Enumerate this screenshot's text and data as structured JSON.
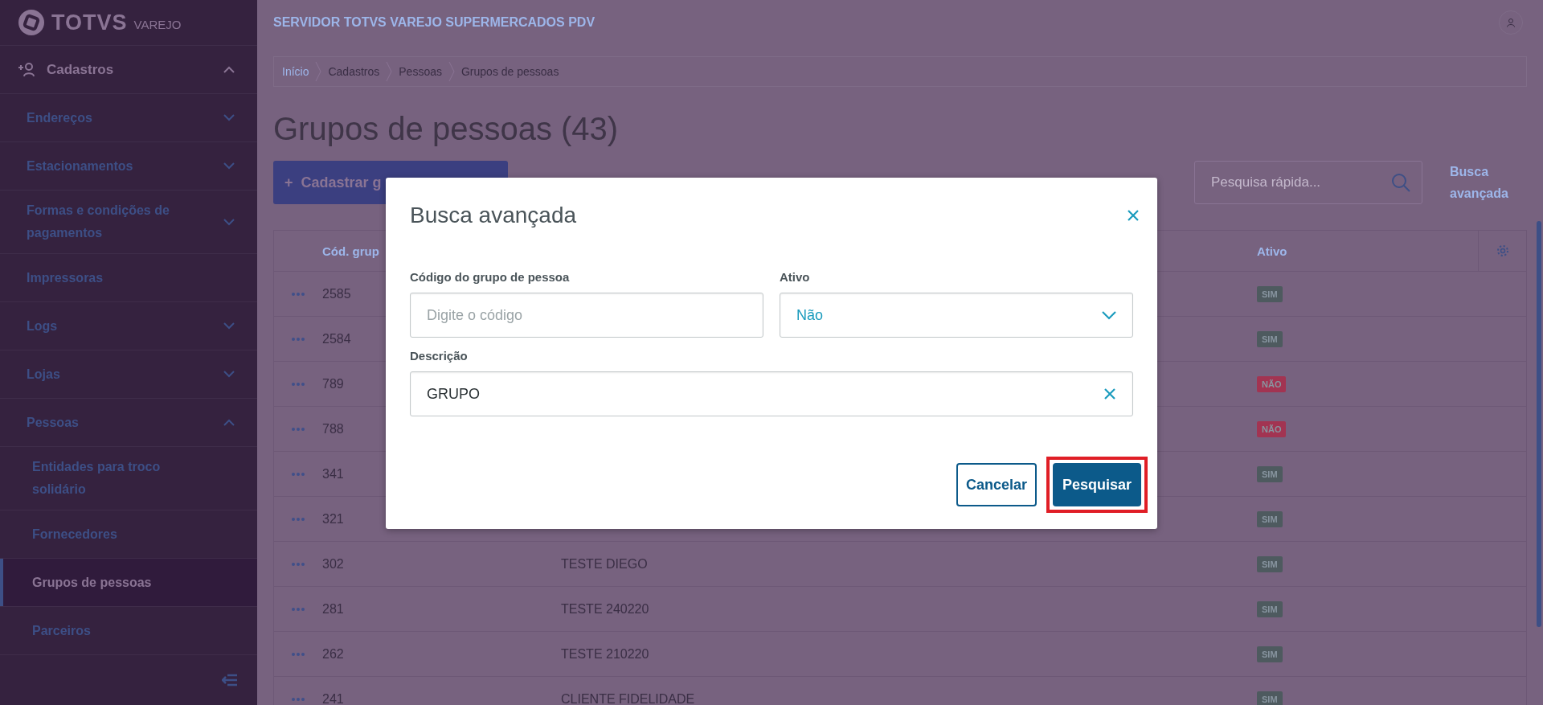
{
  "sidebar": {
    "logo": {
      "brand": "TOTVS",
      "product": "VAREJO"
    },
    "items": [
      {
        "label": "Cadastros",
        "kind": "group",
        "expanded": true,
        "selected": false,
        "children": [
          {
            "label": "Endereços",
            "kind": "group",
            "expanded": false,
            "selected": false
          },
          {
            "label": "Estacionamentos",
            "kind": "group",
            "expanded": false,
            "selected": false
          },
          {
            "label": "Formas e condições de pagamentos",
            "kind": "group",
            "expanded": false,
            "selected": false
          },
          {
            "label": "Impressoras",
            "kind": "link",
            "selected": false
          },
          {
            "label": "Logs",
            "kind": "group",
            "expanded": false,
            "selected": false
          },
          {
            "label": "Lojas",
            "kind": "group",
            "expanded": false,
            "selected": false
          },
          {
            "label": "Pessoas",
            "kind": "group",
            "expanded": true,
            "selected": false,
            "children": [
              {
                "label": "Entidades para troco solidário",
                "kind": "link",
                "selected": false
              },
              {
                "label": "Fornecedores",
                "kind": "link",
                "selected": false
              },
              {
                "label": "Grupos de pessoas",
                "kind": "link",
                "selected": true
              },
              {
                "label": "Parceiros",
                "kind": "link",
                "selected": false
              }
            ]
          }
        ]
      }
    ]
  },
  "header": {
    "title": "SERVIDOR TOTVS VAREJO SUPERMERCADOS PDV"
  },
  "breadcrumb": [
    {
      "label": "Início",
      "kind": "link"
    },
    {
      "label": "Cadastros",
      "kind": "text"
    },
    {
      "label": "Pessoas",
      "kind": "text"
    },
    {
      "label": "Grupos de pessoas",
      "kind": "text"
    }
  ],
  "page_title": "Grupos de pessoas (43)",
  "create_button": {
    "icon": "+",
    "label": "Cadastrar g"
  },
  "search": {
    "placeholder": "Pesquisa rápida..."
  },
  "advanced_search_link": "Busca avançada",
  "table": {
    "columns": [
      "Cód. grup",
      "Ativo"
    ],
    "rows": [
      {
        "code": "2585",
        "active": "SIM",
        "color": "#4e5a5f"
      },
      {
        "code": "2584",
        "active": "SIM",
        "color": "#4e5a5f"
      },
      {
        "code": "789",
        "active": "NÃO",
        "color": "#a23452"
      },
      {
        "code": "788",
        "active": "NÃO",
        "color": "#a23452"
      },
      {
        "code": "341",
        "active": "SIM",
        "color": "#4e5a5f"
      },
      {
        "code": "321",
        "active": "SIM",
        "color": "#4e5a5f"
      },
      {
        "code": "302",
        "description": "TESTE DIEGO",
        "active": "SIM",
        "color": "#4e5a5f"
      },
      {
        "code": "281",
        "description": "TESTE 240220",
        "active": "SIM",
        "color": "#4e5a5f"
      },
      {
        "code": "262",
        "description": "TESTE 210220",
        "active": "SIM",
        "color": "#4e5a5f"
      },
      {
        "code": "241",
        "description": "CLIENTE FIDELIDADE",
        "active": "SIM",
        "color": "#4e5a5f"
      }
    ]
  },
  "modal": {
    "title": "Busca avançada",
    "fields": [
      {
        "kind": "text",
        "label": "Código do grupo de pessoa",
        "placeholder": "Digite o código"
      },
      {
        "kind": "select",
        "label": "Ativo",
        "value": "Não"
      },
      {
        "kind": "clearable",
        "label": "Descrição",
        "value": "GRUPO"
      }
    ],
    "buttons": [
      {
        "label": "Cancelar",
        "kind": "secondary",
        "highlighted": false
      },
      {
        "label": "Pesquisar",
        "kind": "primary",
        "highlighted": true
      }
    ]
  }
}
